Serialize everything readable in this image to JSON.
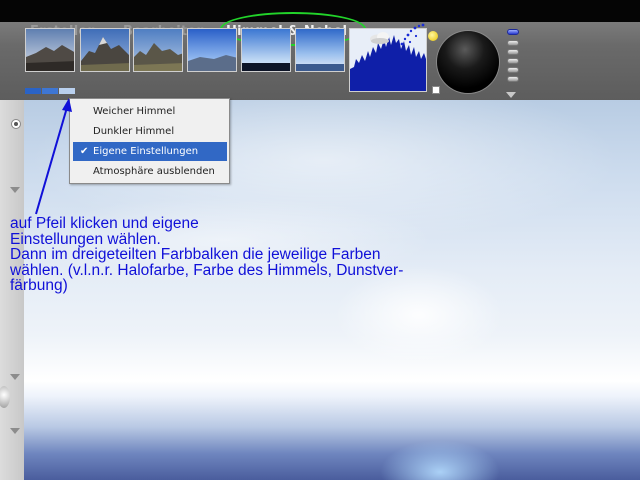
{
  "toolbar": {
    "tabs": [
      {
        "label": "Erstellen",
        "active": false
      },
      {
        "label": "Bearbeiten",
        "active": false
      },
      {
        "label": "Himmel & Nebel",
        "active": true
      }
    ],
    "tab_arrow": "›",
    "highlight_color": "#22d42a",
    "presets_count": 6
  },
  "dropdown": {
    "items": [
      {
        "label": "Weicher Himmel",
        "checked": false
      },
      {
        "label": "Dunkler Himmel",
        "checked": false
      },
      {
        "label": "Eigene Einstellungen",
        "checked": true
      },
      {
        "label": "Atmosphäre ausblenden",
        "checked": false
      }
    ],
    "check_glyph": "✔",
    "selected_color": "#3168c5"
  },
  "annotation": {
    "color": "#1010d8",
    "lines": [
      "auf Pfeil klicken und eigene",
      "Einstellungen wählen.",
      "Dann im dreigeteilten Farbbalken die jeweilige Farben",
      "wählen. (v.l.n.r. Halofarbe, Farbe des Himmels, Dunstver-",
      "färbung)"
    ]
  }
}
